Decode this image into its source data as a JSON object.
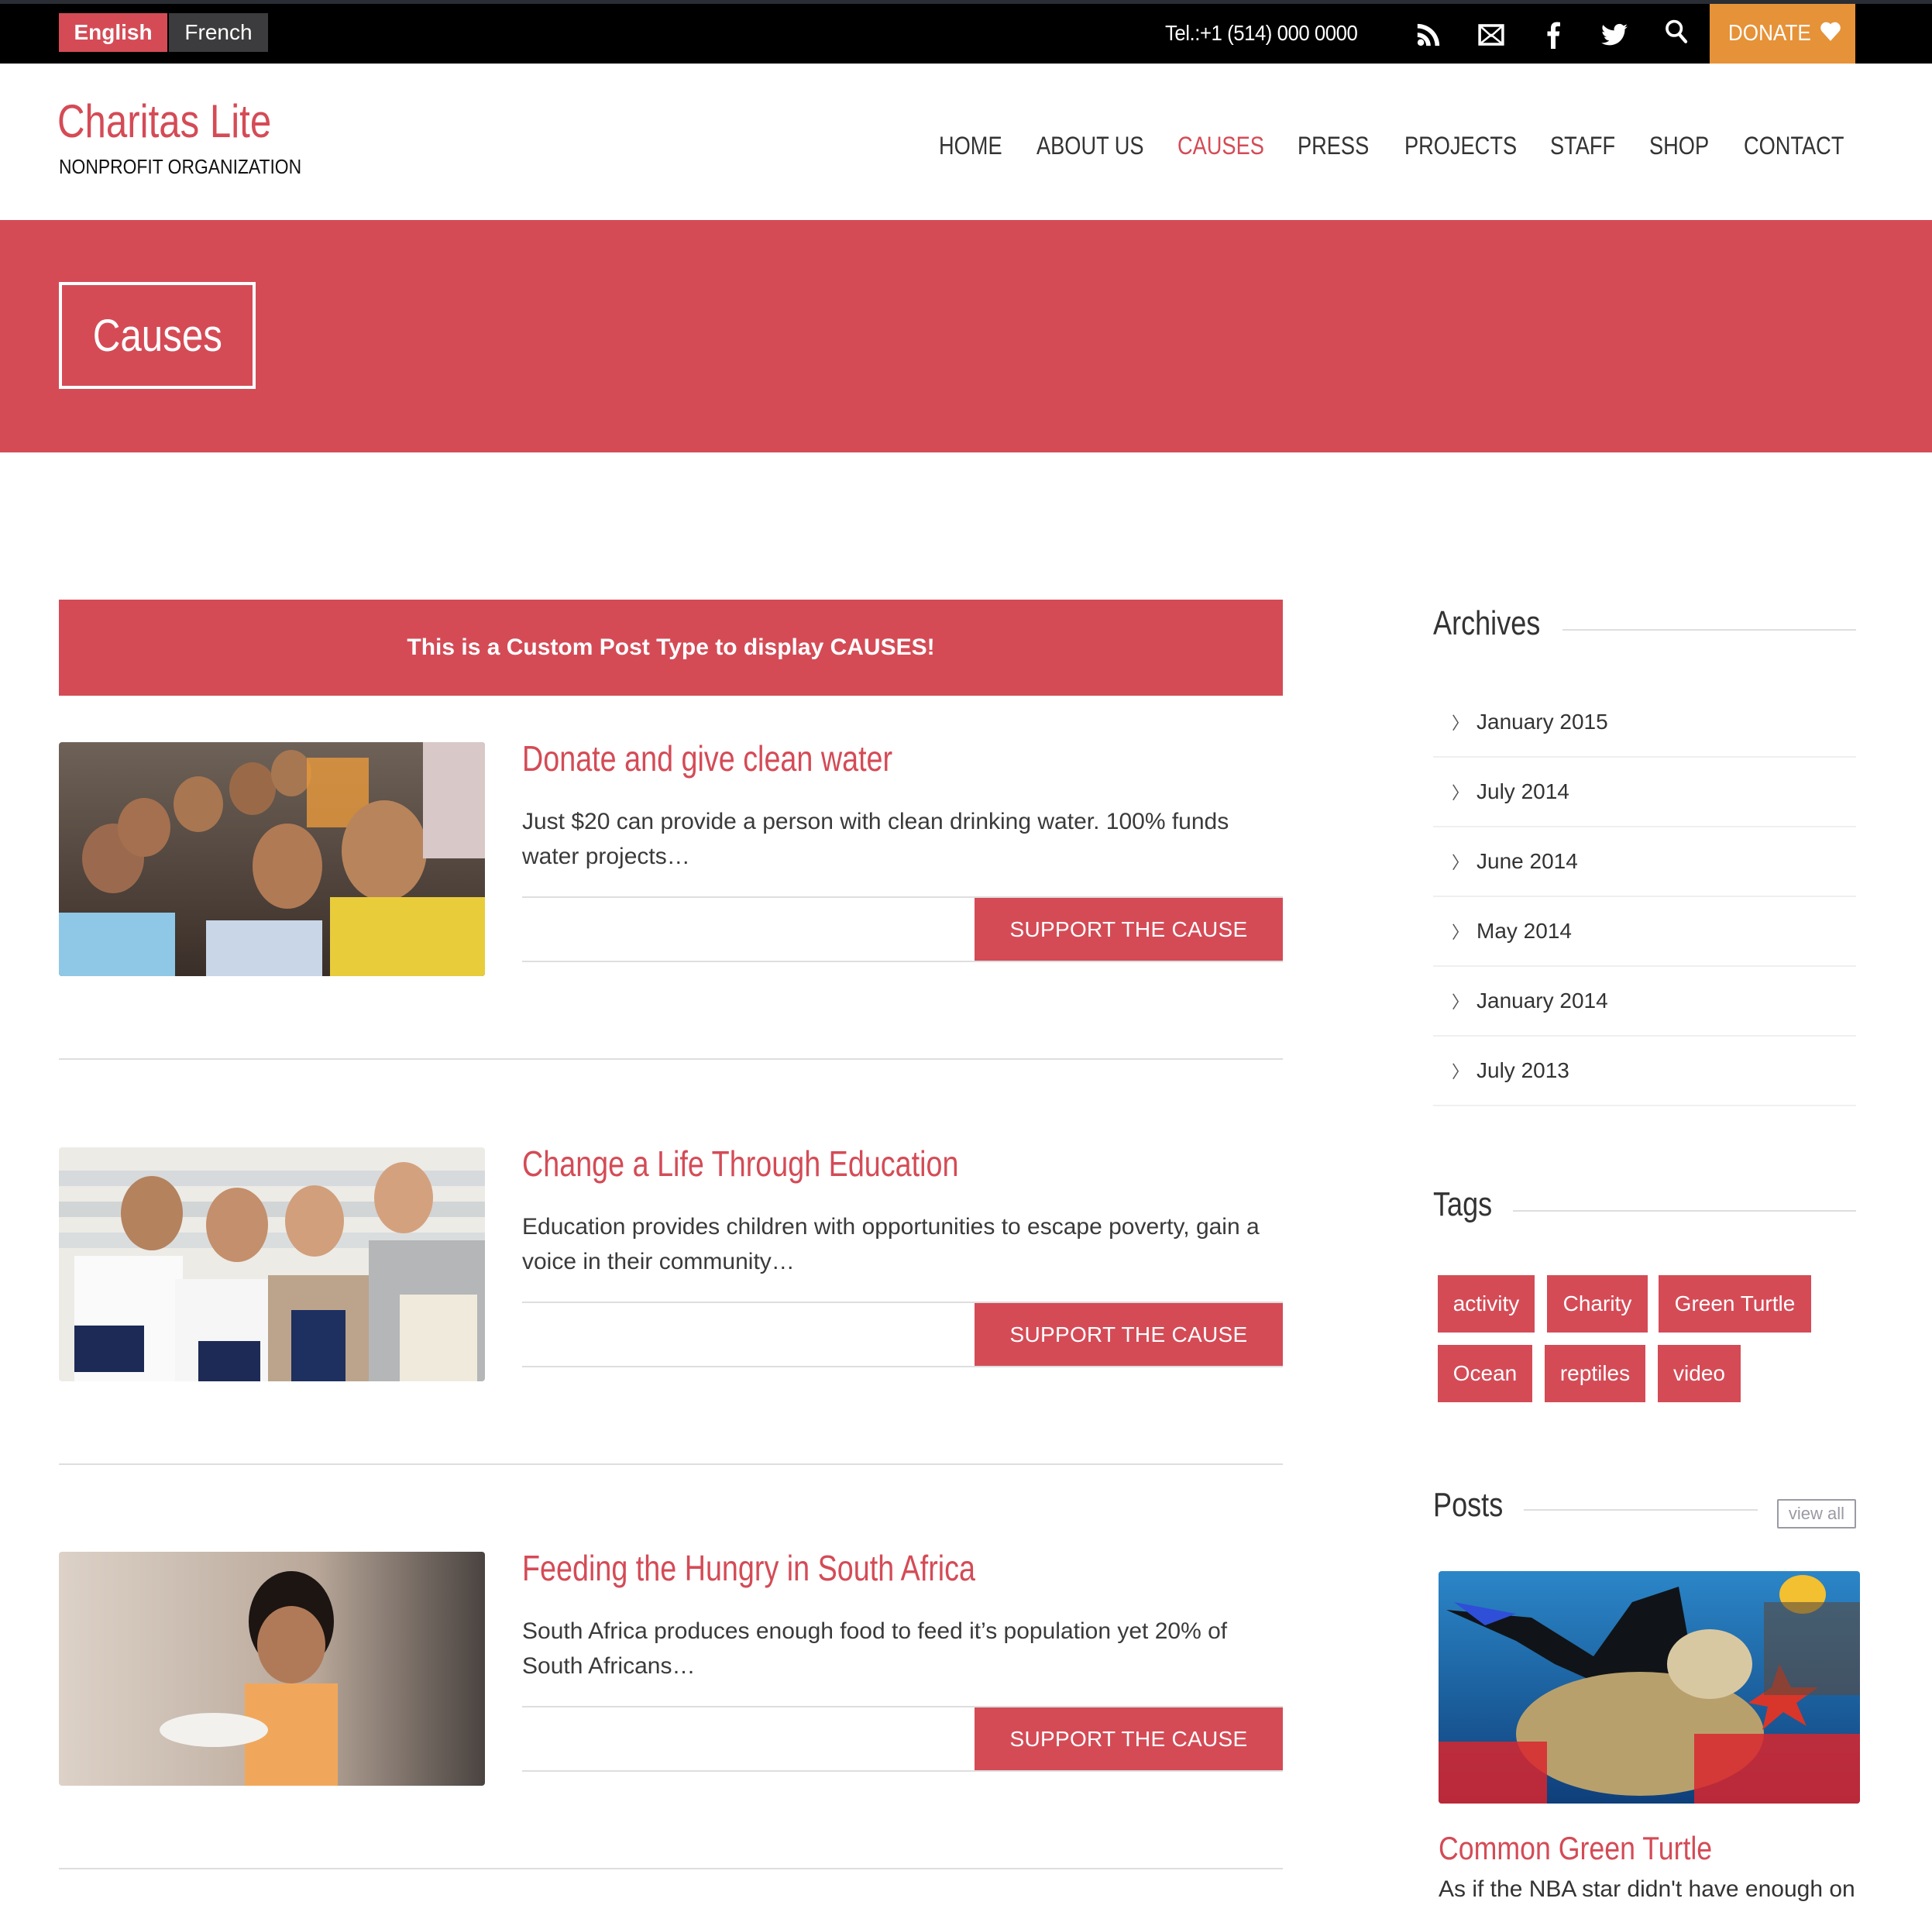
{
  "topbar": {
    "languages": [
      {
        "label": "English",
        "active": true
      },
      {
        "label": "French",
        "active": false
      }
    ],
    "phone": "Tel.:+1 (514) 000 0000",
    "icons": [
      "rss-icon",
      "mail-icon",
      "facebook-icon",
      "twitter-icon",
      "search-icon"
    ],
    "donate_label": "DONATE",
    "colors": {
      "accent": "#d44b56",
      "donate": "#e69238"
    }
  },
  "header": {
    "site_title": "Charitas Lite",
    "tagline": "NONPROFIT ORGANIZATION",
    "nav": [
      {
        "label": "HOME",
        "active": false
      },
      {
        "label": "ABOUT US",
        "active": false
      },
      {
        "label": "CAUSES",
        "active": true
      },
      {
        "label": "PRESS",
        "active": false
      },
      {
        "label": "PROJECTS",
        "active": false
      },
      {
        "label": "STAFF",
        "active": false
      },
      {
        "label": "SHOP",
        "active": false
      },
      {
        "label": "CONTACT",
        "active": false
      }
    ]
  },
  "hero": {
    "title": "Causes"
  },
  "notice": "This is a Custom Post Type to display CAUSES!",
  "causes": [
    {
      "title": "Donate and give clean water",
      "excerpt": "Just $20 can provide a person with clean drinking water. 100% funds water projects…",
      "button": "SUPPORT THE CAUSE",
      "image": "children group photo"
    },
    {
      "title": "Change a Life Through Education",
      "excerpt": "Education provides children with opportunities to escape poverty, gain a voice in their community…",
      "button": "SUPPORT THE CAUSE",
      "image": "students with books photo"
    },
    {
      "title": "Feeding the Hungry in South Africa",
      "excerpt": "South Africa produces enough food to feed it’s population yet 20% of South Africans…",
      "button": "SUPPORT THE CAUSE",
      "image": "child with bowl photo"
    }
  ],
  "sidebar": {
    "archives": {
      "title": "Archives",
      "items": [
        "January 2015",
        "July 2014",
        "June 2014",
        "May 2014",
        "January 2014",
        "July 2013"
      ]
    },
    "tags": {
      "title": "Tags",
      "items": [
        "activity",
        "Charity",
        "Green Turtle",
        "Ocean",
        "reptiles",
        "video"
      ]
    },
    "posts": {
      "title": "Posts",
      "view_all": "view all",
      "items": [
        {
          "title": "Common Green Turtle",
          "excerpt": "As if the NBA star didn't have enough on",
          "image": "sea turtle and diver photo"
        }
      ]
    }
  }
}
